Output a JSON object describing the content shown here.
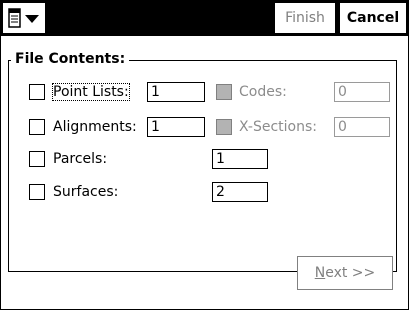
{
  "titlebar": {
    "menu_icon": "notepad-menu-icon",
    "finish_label": "Finish",
    "cancel_label": "Cancel"
  },
  "file_contents": {
    "title": "File Contents:",
    "rows": [
      {
        "label": "Point Lists:",
        "checked": false,
        "value": "1"
      },
      {
        "label": "Alignments:",
        "checked": false,
        "value": "1"
      },
      {
        "label": "Parcels:",
        "checked": false,
        "value": "1"
      },
      {
        "label": "Surfaces:",
        "checked": false,
        "value": "2"
      }
    ],
    "codes": {
      "label": "Codes:",
      "value": "0",
      "enabled": false
    },
    "xsections": {
      "label": "X-Sections:",
      "value": "0",
      "enabled": false
    }
  },
  "footer": {
    "next_mnemonic": "N",
    "next_rest": "ext >>"
  }
}
